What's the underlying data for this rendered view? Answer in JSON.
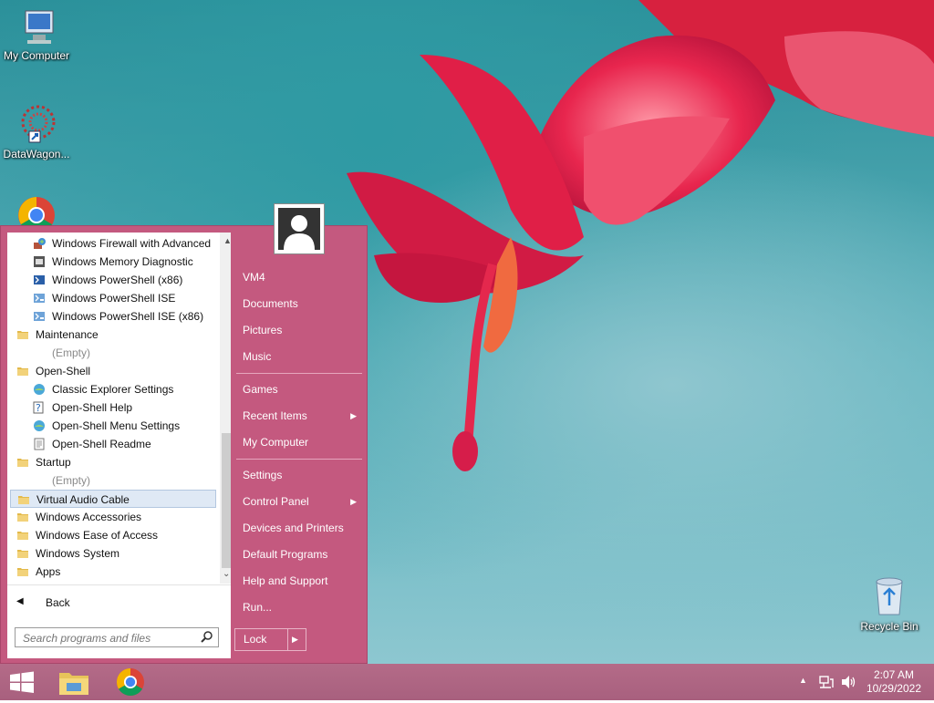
{
  "desktop": {
    "icons": [
      {
        "label": "My Computer"
      },
      {
        "label": "DataWagon..."
      },
      {
        "label": "Recycle Bin"
      }
    ]
  },
  "start_menu": {
    "programs": [
      {
        "label": "Windows Firewall with Advanced",
        "icon": "firewall-icon",
        "indent": true
      },
      {
        "label": "Windows Memory Diagnostic",
        "icon": "memory-diagnostic-icon",
        "indent": true
      },
      {
        "label": "Windows PowerShell (x86)",
        "icon": "powershell-icon",
        "indent": true
      },
      {
        "label": "Windows PowerShell ISE",
        "icon": "powershell-ise-icon",
        "indent": true
      },
      {
        "label": "Windows PowerShell ISE (x86)",
        "icon": "powershell-ise-icon",
        "indent": true
      },
      {
        "label": "Maintenance",
        "icon": "folder-icon",
        "indent": false
      },
      {
        "label": "(Empty)",
        "icon": "",
        "indent": true,
        "empty": true
      },
      {
        "label": "Open-Shell",
        "icon": "folder-icon",
        "indent": false
      },
      {
        "label": "Classic Explorer Settings",
        "icon": "shell-settings-icon",
        "indent": true
      },
      {
        "label": "Open-Shell Help",
        "icon": "help-icon",
        "indent": true
      },
      {
        "label": "Open-Shell Menu Settings",
        "icon": "shell-settings-icon",
        "indent": true
      },
      {
        "label": "Open-Shell Readme",
        "icon": "document-icon",
        "indent": true
      },
      {
        "label": "Startup",
        "icon": "folder-icon",
        "indent": false
      },
      {
        "label": "(Empty)",
        "icon": "",
        "indent": true,
        "empty": true
      },
      {
        "label": "Virtual Audio Cable",
        "icon": "folder-icon",
        "indent": false,
        "selected": true
      },
      {
        "label": "Windows Accessories",
        "icon": "folder-icon",
        "indent": false
      },
      {
        "label": "Windows Ease of Access",
        "icon": "folder-icon",
        "indent": false
      },
      {
        "label": "Windows System",
        "icon": "folder-icon",
        "indent": false
      },
      {
        "label": "Apps",
        "icon": "folder-icon",
        "indent": false
      }
    ],
    "back_label": "Back",
    "search_placeholder": "Search programs and files",
    "right_items": [
      {
        "label": "VM4"
      },
      {
        "label": "Documents"
      },
      {
        "label": "Pictures"
      },
      {
        "label": "Music"
      },
      {
        "label": "Games"
      },
      {
        "label": "Recent Items",
        "submenu": true
      },
      {
        "label": "My Computer"
      },
      {
        "label": "Settings"
      },
      {
        "label": "Control Panel",
        "submenu": true
      },
      {
        "label": "Devices and Printers"
      },
      {
        "label": "Default Programs"
      },
      {
        "label": "Help and Support"
      },
      {
        "label": "Run..."
      }
    ],
    "lock_label": "Lock"
  },
  "taskbar": {
    "time": "2:07 AM",
    "date": "10/29/2022"
  },
  "colors": {
    "menu_bg": "#c4597f",
    "taskbar_bg": "#b46b88",
    "selection": "#dfe9f5"
  }
}
